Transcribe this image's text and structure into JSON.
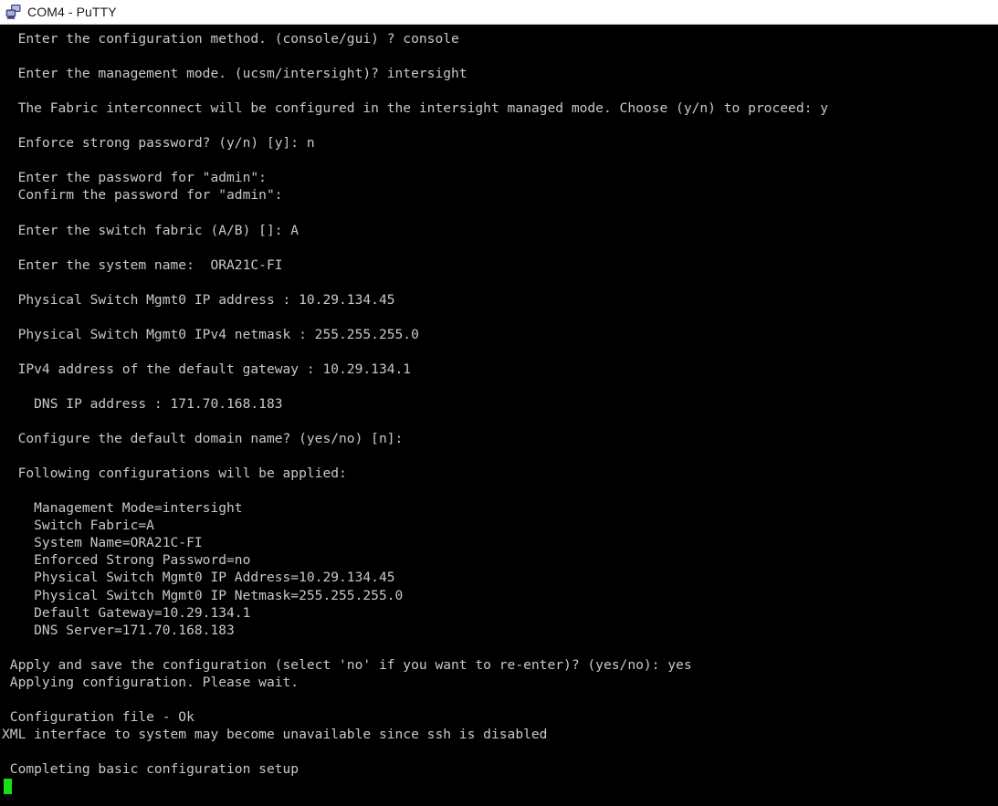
{
  "window": {
    "title": "COM4 - PuTTY",
    "icon": "putty-computer-icon",
    "titlebar_bg": "#ffffff",
    "titlebar_text_color": "#1a1a1a"
  },
  "terminal": {
    "background": "#000000",
    "foreground": "#c9c9c9",
    "cursor_color": "#18e018",
    "cursor_shape": "block",
    "cursor_column": 0,
    "lines": [
      "  Enter the configuration method. (console/gui) ? console",
      "",
      "  Enter the management mode. (ucsm/intersight)? intersight",
      "",
      "  The Fabric interconnect will be configured in the intersight managed mode. Choose (y/n) to proceed: y",
      "",
      "  Enforce strong password? (y/n) [y]: n",
      "",
      "  Enter the password for \"admin\":",
      "  Confirm the password for \"admin\":",
      "",
      "  Enter the switch fabric (A/B) []: A",
      "",
      "  Enter the system name:  ORA21C-FI",
      "",
      "  Physical Switch Mgmt0 IP address : 10.29.134.45",
      "",
      "  Physical Switch Mgmt0 IPv4 netmask : 255.255.255.0",
      "",
      "  IPv4 address of the default gateway : 10.29.134.1",
      "",
      "    DNS IP address : 171.70.168.183",
      "",
      "  Configure the default domain name? (yes/no) [n]:",
      "",
      "  Following configurations will be applied:",
      "",
      "    Management Mode=intersight",
      "    Switch Fabric=A",
      "    System Name=ORA21C-FI",
      "    Enforced Strong Password=no",
      "    Physical Switch Mgmt0 IP Address=10.29.134.45",
      "    Physical Switch Mgmt0 IP Netmask=255.255.255.0",
      "    Default Gateway=10.29.134.1",
      "    DNS Server=171.70.168.183",
      "",
      " Apply and save the configuration (select 'no' if you want to re-enter)? (yes/no): yes",
      " Applying configuration. Please wait.",
      "",
      " Configuration file - Ok",
      "XML interface to system may become unavailable since ssh is disabled",
      "",
      " Completing basic configuration setup"
    ]
  }
}
